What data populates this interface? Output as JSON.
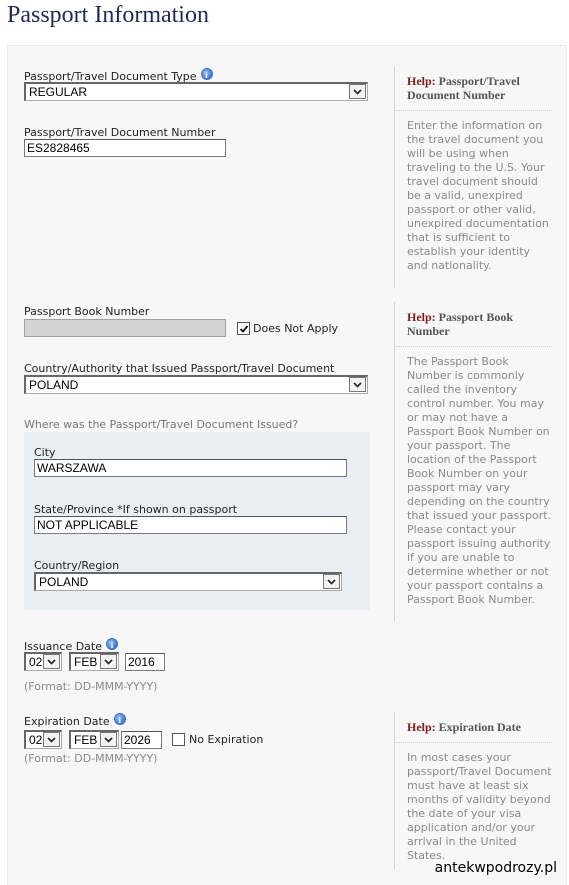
{
  "page_title": "Passport Information",
  "fields": {
    "doc_type": {
      "label": "Passport/Travel Document Type",
      "value": "REGULAR"
    },
    "doc_number": {
      "label": "Passport/Travel Document Number",
      "value": "ES2828465"
    },
    "book_number": {
      "label": "Passport Book Number",
      "value": "",
      "does_not_apply_label": "Does Not Apply",
      "does_not_apply_checked": true
    },
    "issuing_country": {
      "label": "Country/Authority that Issued Passport/Travel Document",
      "value": "POLAND"
    },
    "issued_where": {
      "heading": "Where was the Passport/Travel Document Issued?",
      "city": {
        "label": "City",
        "value": "WARSZAWA"
      },
      "state": {
        "label": "State/Province *If shown on passport",
        "value": "NOT APPLICABLE"
      },
      "country": {
        "label": "Country/Region",
        "value": "POLAND"
      }
    },
    "issuance_date": {
      "label": "Issuance Date",
      "day": "02",
      "month": "FEB",
      "year": "2016",
      "format": "(Format: DD-MMM-YYYY)"
    },
    "expiration_date": {
      "label": "Expiration Date",
      "day": "02",
      "month": "FEB",
      "year": "2026",
      "format": "(Format: DD-MMM-YYYY)",
      "no_expiration_label": "No Expiration",
      "no_expiration_checked": false
    }
  },
  "help": [
    {
      "prefix": "Help:",
      "title": "Passport/Travel Document Number",
      "body": "Enter the information on the travel document you will be using when traveling to the U.S. Your travel document should be a valid, unexpired passport or other valid, unexpired documentation that is sufficient to establish your identity and nationality."
    },
    {
      "prefix": "Help:",
      "title": "Passport Book Number",
      "body": "The Passport Book Number is commonly called the inventory control number. You may or may not have a Passport Book Number on your passport. The location of the Passport Book Number on your passport may vary depending on the country that issued your passport. Please contact your passport issuing authority if you are unable to determine whether or not your passport contains a Passport Book Number."
    },
    {
      "prefix": "Help:",
      "title": "Expiration Date",
      "body": "In most cases your passport/Travel Document must have at least six months of validity beyond the date of your visa application and/or your arrival in the United States."
    }
  ],
  "icons": {
    "info": "info-icon",
    "dropdown": "chevron-down-icon",
    "check": "checkmark-icon"
  },
  "colors": {
    "title": "#1f2a5a",
    "help_prefix": "#7a1e1e",
    "panel_bg": "#f7f7f7",
    "issued_box_bg": "#e9eef5"
  },
  "watermark": "antekwpodrozy.pl"
}
